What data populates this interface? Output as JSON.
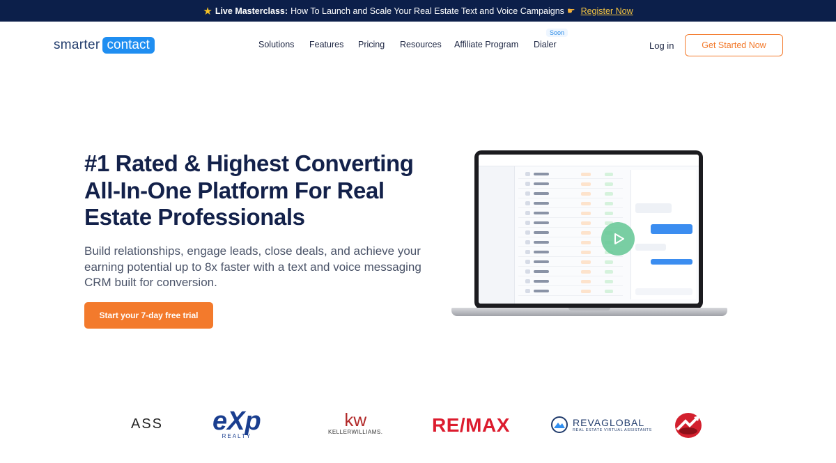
{
  "announcement": {
    "bold": "Live Masterclass:",
    "text": "How To Launch and Scale Your Real Estate Text and Voice Campaigns",
    "link": "Register Now"
  },
  "brand": {
    "part1": "smarter",
    "part2": "contact"
  },
  "nav": {
    "items": [
      "Solutions",
      "Features",
      "Pricing",
      "Resources",
      "Affiliate Program",
      "Dialer"
    ],
    "soon_badge": "Soon",
    "login": "Log in",
    "cta": "Get Started Now"
  },
  "hero": {
    "title": "#1 Rated & Highest Converting All-In-One Platform For Real Estate Professionals",
    "subtitle": "Build relationships, engage leads, close deals, and achieve your earning potential up to 8x faster with a text and voice messaging CRM built for conversion.",
    "cta": "Start your 7-day free trial"
  },
  "partners": {
    "ass": "ASS",
    "exp_main": "eXp",
    "exp_sub": "REALTY",
    "kw_main": "kw",
    "kw_sub": "KELLERWILLIAMS.",
    "remax": "RE/MAX",
    "reva_main": "REVAGLOBAL",
    "reva_sub": "REAL ESTATE VIRTUAL ASSISTANTS"
  },
  "colors": {
    "accent": "#f37a2c",
    "navy": "#0c1f4a",
    "brand_blue": "#1f8ef1"
  },
  "icons": [
    "star-icon",
    "pointing-hand-icon",
    "play-icon"
  ]
}
